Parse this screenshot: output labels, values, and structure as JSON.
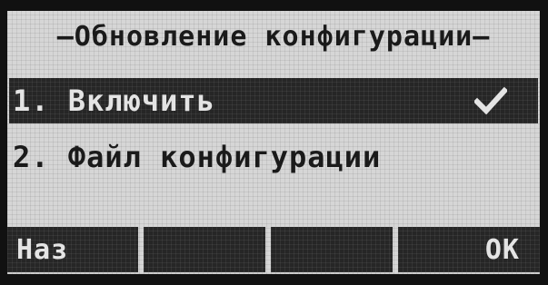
{
  "screen": {
    "title": "—Обновление конфигурации—"
  },
  "menu": {
    "items": [
      {
        "label": "1. Включить",
        "selected": true,
        "checked": true
      },
      {
        "label": "2. Файл конфигурации",
        "selected": false,
        "checked": false
      }
    ],
    "check_icon": "checkmark-icon"
  },
  "softkeys": {
    "key1": "Наз",
    "key2": "",
    "key3": "",
    "key4": "OK"
  },
  "colors": {
    "lcd_background": "#d6d6d6",
    "highlight": "#262626",
    "text_dark": "#1a1a1a",
    "text_light": "#e4e4e4"
  }
}
